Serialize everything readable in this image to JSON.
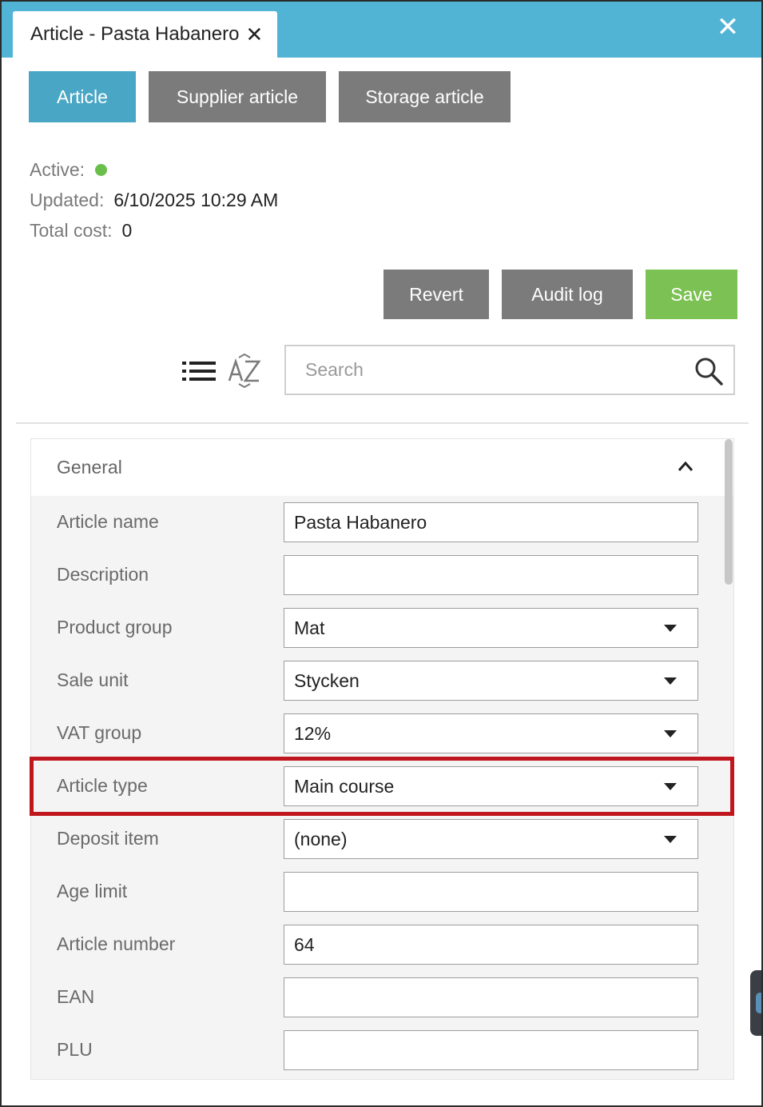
{
  "window": {
    "tab_title": "Article - Pasta Habanero",
    "tab_close_glyph": "✕",
    "close_glyph": "✕"
  },
  "tabs": [
    {
      "label": "Article",
      "selected": true
    },
    {
      "label": "Supplier article",
      "selected": false
    },
    {
      "label": "Storage article",
      "selected": false
    }
  ],
  "info": {
    "active_label": "Active:",
    "active_status_color": "#6abf4b",
    "updated_label": "Updated:",
    "updated_value": "6/10/2025 10:29 AM",
    "total_cost_label": "Total cost:",
    "total_cost_value": "0"
  },
  "actions": {
    "revert_label": "Revert",
    "audit_label": "Audit log",
    "save_label": "Save"
  },
  "search": {
    "placeholder": "Search"
  },
  "panel": {
    "title": "General",
    "rows": [
      {
        "label": "Article name",
        "value": "Pasta Habanero",
        "kind": "text"
      },
      {
        "label": "Description",
        "value": "",
        "kind": "text"
      },
      {
        "label": "Product group",
        "value": "Mat",
        "kind": "dropdown"
      },
      {
        "label": "Sale unit",
        "value": "Stycken",
        "kind": "dropdown"
      },
      {
        "label": "VAT group",
        "value": "12%",
        "kind": "dropdown"
      },
      {
        "label": "Article type",
        "value": "Main course",
        "kind": "dropdown"
      },
      {
        "label": "Deposit item",
        "value": "(none)",
        "kind": "dropdown"
      },
      {
        "label": "Age limit",
        "value": "",
        "kind": "text"
      },
      {
        "label": "Article number",
        "value": "64",
        "kind": "text"
      },
      {
        "label": "EAN",
        "value": "",
        "kind": "text"
      },
      {
        "label": "PLU",
        "value": "",
        "kind": "text"
      }
    ]
  },
  "colors": {
    "titlebar": "#52b4d4",
    "tab_selected": "#4aa6c5",
    "tab_default": "#7b7b7b",
    "save": "#7cc153",
    "highlight": "#c0161e"
  },
  "icons": [
    "list-view-icon",
    "sort-az-icon",
    "search-icon",
    "chevron-up-icon",
    "caret-down-icon"
  ]
}
